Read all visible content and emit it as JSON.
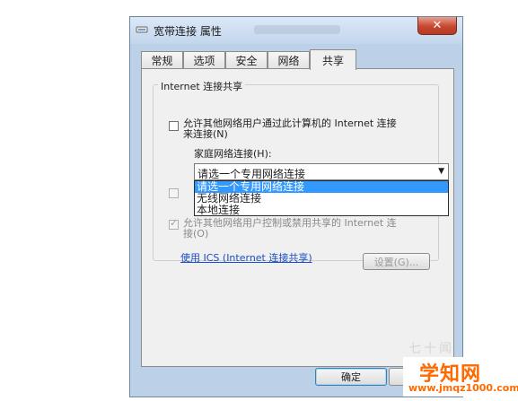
{
  "window": {
    "title": "宽带连接 属性",
    "close_label": "✕"
  },
  "tabs": [
    {
      "label": "常规"
    },
    {
      "label": "选项"
    },
    {
      "label": "安全"
    },
    {
      "label": "网络"
    },
    {
      "label": "共享",
      "active": true
    }
  ],
  "group": {
    "title": "Internet 连接共享",
    "allow_share_label_1": "允许其他网络用户通过此计算机的 Internet 连接",
    "allow_share_label_2": "来连接(N)",
    "allow_share_checked": false,
    "home_network_label": "家庭网络连接(H):",
    "home_network_value": "请选一个专用网络连接",
    "home_network_options": [
      "请选一个专用网络连接",
      "无线网络连接",
      "本地连接"
    ],
    "allow_control_label_1": "允许其他网络用户控制或禁用共享的 Internet 连",
    "allow_control_label_2": "接(O)",
    "allow_control_checked": true,
    "ics_link": "使用 ICS (Internet 连接共享)",
    "settings_button": "设置(G)..."
  },
  "footer": {
    "ok_button": "确定"
  },
  "watermark": {
    "text": "学知网",
    "url": "www.jmqz1000.com",
    "faint": "七十闻"
  }
}
